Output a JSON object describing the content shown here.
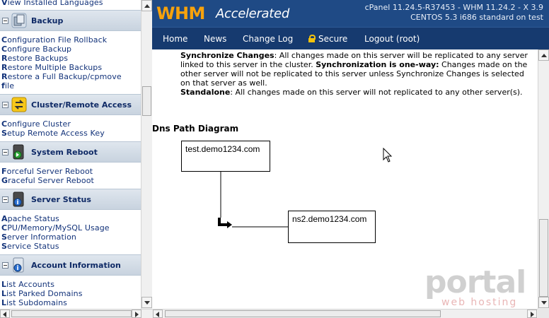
{
  "sidebar": {
    "top_link": "View Installed Languages",
    "categories": [
      {
        "label": "Backup",
        "links": [
          "Configuration File Rollback",
          "Configure Backup",
          "Restore Backups",
          "Restore Multiple Backups",
          "Restore a Full Backup/cpmove",
          "file"
        ]
      },
      {
        "label": "Cluster/Remote Access",
        "links": [
          "Configure Cluster",
          "Setup Remote Access Key"
        ]
      },
      {
        "label": "System Reboot",
        "links": [
          "Forceful Server Reboot",
          "Graceful Server Reboot"
        ]
      },
      {
        "label": "Server Status",
        "links": [
          "Apache Status",
          "CPU/Memory/MySQL Usage",
          "Server Information",
          "Service Status"
        ]
      },
      {
        "label": "Account Information",
        "links": [
          "List Accounts",
          "List Parked Domains",
          "List Subdomains"
        ]
      }
    ]
  },
  "header": {
    "logo_whm": "WHM",
    "logo_accelerated": "Accelerated",
    "version_line": "cPanel 11.24.5-R37453 - WHM 11.24.2 - X 3.9",
    "os_line": "CENTOS 5.3 i686 standard on test"
  },
  "nav": {
    "items": [
      "Home",
      "News",
      "Change Log",
      "Secure",
      "Logout (root)"
    ]
  },
  "main": {
    "sync_label": "Synchronize Changes",
    "sync_text": ": All changes made on this server will be replicated to any server linked to this server in the cluster. ",
    "oneway_label": "Synchronization is one-way:",
    "oneway_text": " Changes made on the other server will not be replicated to this server unless Synchronize Changes is selected on that server as well.",
    "standalone_label": "Standalone",
    "standalone_text": ": All changes made on this server will not replicated to any other server(s).",
    "diagram_title": "Dns Path Diagram",
    "diagram": {
      "source_host": "test.demo1234.com",
      "target_host": "ns2.demo1234.com"
    }
  },
  "watermark": {
    "main": "portal",
    "sub": "web hosting"
  },
  "colors": {
    "header_bg": "#1f4a85",
    "nav_bg": "#163a6f",
    "logo_accent": "#f7a20c",
    "sidebar_link": "#13337a"
  }
}
